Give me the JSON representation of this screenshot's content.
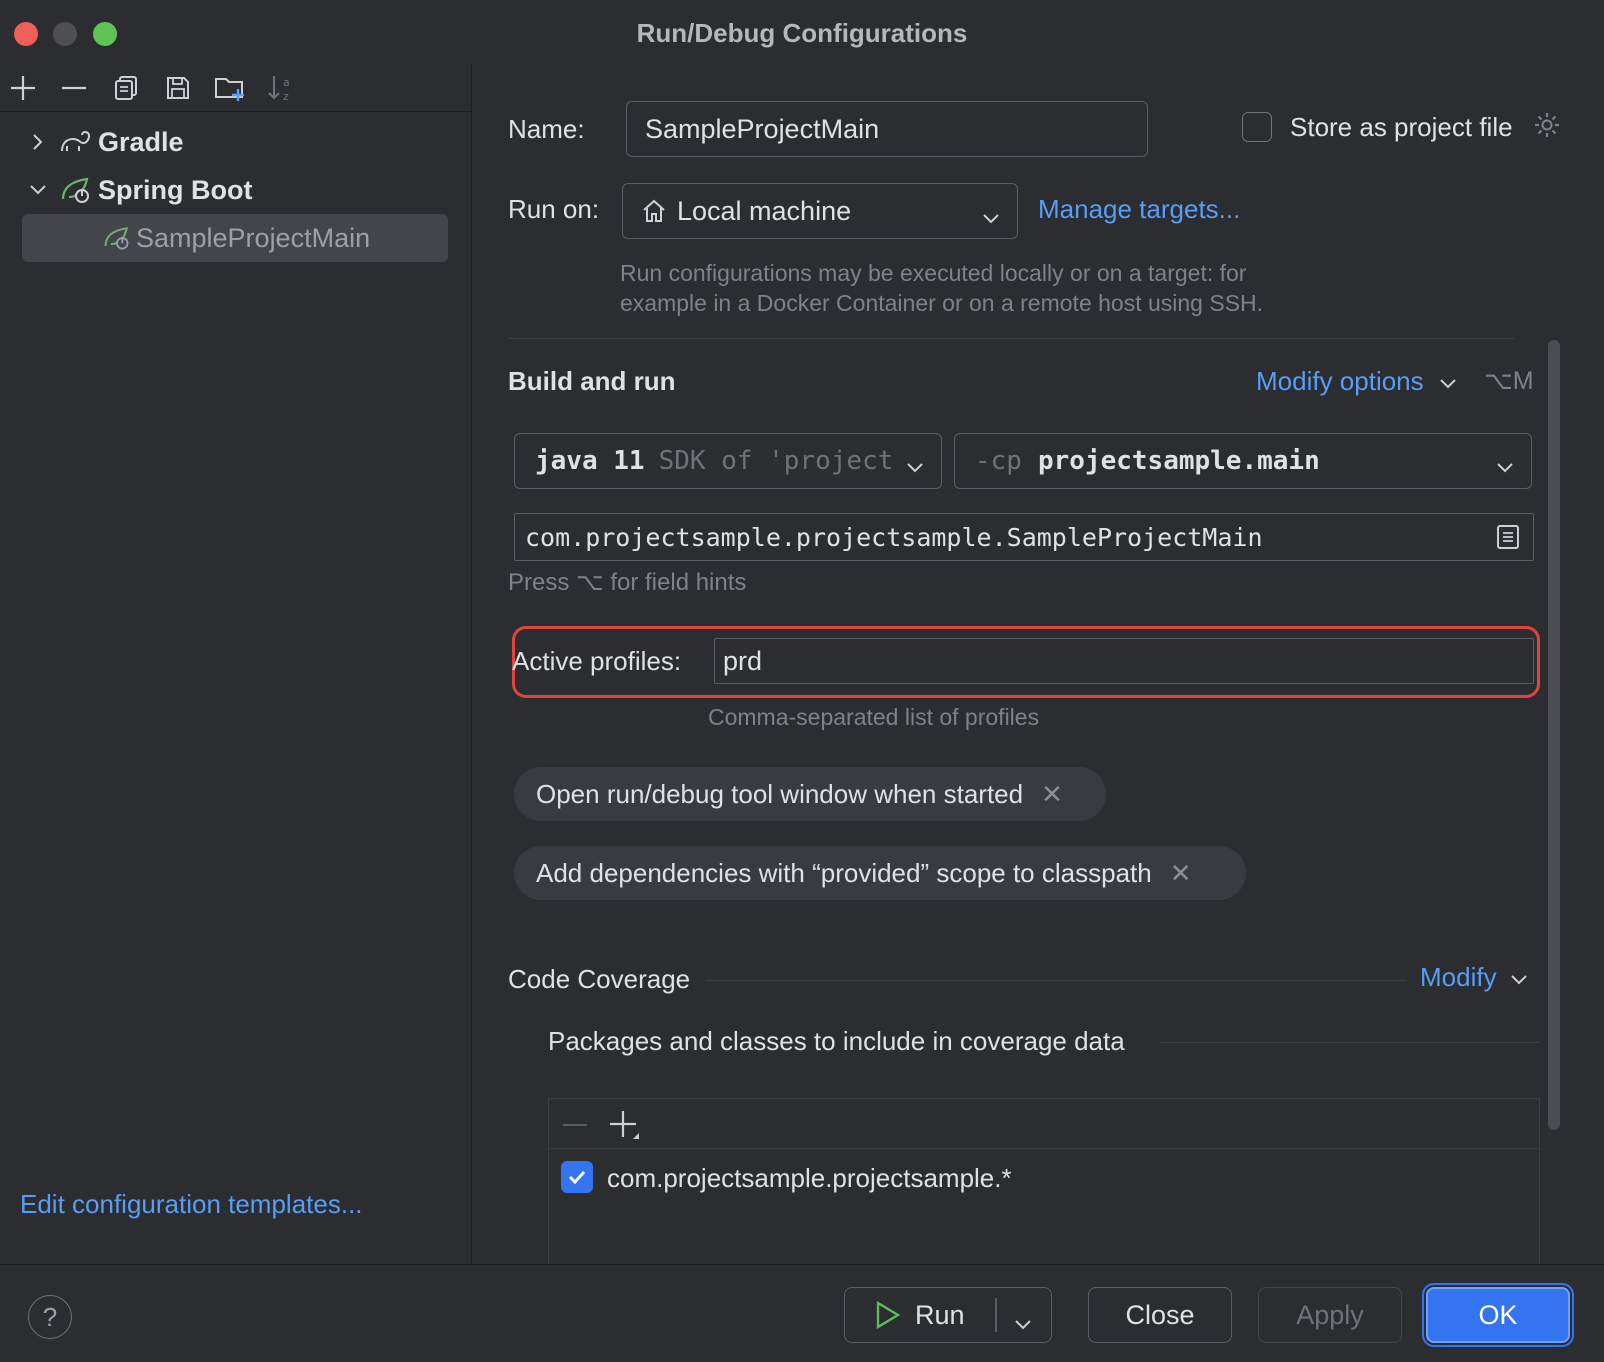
{
  "window": {
    "title": "Run/Debug Configurations"
  },
  "tree": {
    "gradle": "Gradle",
    "spring_boot": "Spring Boot",
    "config": "SampleProjectMain"
  },
  "edit_templates": "Edit configuration templates...",
  "form": {
    "name_label": "Name:",
    "name_value": "SampleProjectMain",
    "store_label": "Store as project file",
    "run_on_label": "Run on:",
    "run_on_value": "Local machine",
    "manage_targets": "Manage targets...",
    "run_on_hint_line1": "Run configurations may be executed locally or on a target: for",
    "run_on_hint_line2": "example in a Docker Container or on a remote host using SSH.",
    "build_run_title": "Build and run",
    "modify_options": "Modify options",
    "modify_options_shortcut": "⌥M",
    "jdk_name": "java 11",
    "jdk_desc": "SDK of 'project",
    "cp_prefix": "-cp",
    "cp_value": "projectsample.main",
    "main_class": "com.projectsample.projectsample.SampleProjectMain",
    "field_hint": "Press ⌥ for field hints",
    "active_profiles_label": "Active profiles:",
    "active_profiles_value": "prd",
    "active_profiles_hint": "Comma-separated list of profiles",
    "chips": [
      "Open run/debug tool window when started",
      "Add dependencies with “provided” scope to classpath"
    ],
    "coverage_title": "Code Coverage",
    "coverage_modify": "Modify",
    "coverage_packages_title": "Packages and classes to include in coverage data",
    "coverage_item": "com.projectsample.projectsample.*"
  },
  "buttons": {
    "help": "?",
    "run": "Run",
    "close": "Close",
    "apply": "Apply",
    "ok": "OK"
  },
  "colors": {
    "accent": "#3574f0",
    "link": "#589df6",
    "highlight_ring": "#e0443a",
    "spring_green": "#6db36d"
  }
}
